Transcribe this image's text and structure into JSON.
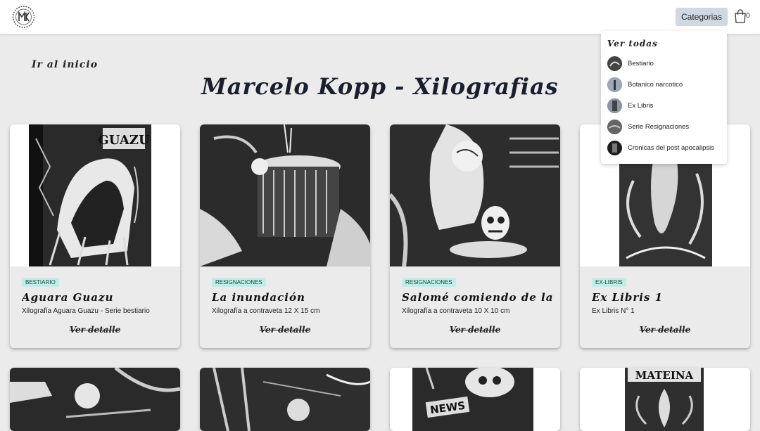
{
  "header": {
    "logo_icon": "mk-monogram-logo",
    "categories_label": "Categorias",
    "cart_icon": "shopping-bag-icon",
    "cart_count": "0"
  },
  "dropdown": {
    "all_label": "Ver todas",
    "items": [
      {
        "label": "Bestiario"
      },
      {
        "label": "Botanico narcotico"
      },
      {
        "label": "Ex Libris"
      },
      {
        "label": "Serie Resignaciones"
      },
      {
        "label": "Cronicas del post apocalipsis"
      }
    ]
  },
  "home_link": "Ir al inicio",
  "page_title": "Marcelo Kopp - Xilografias",
  "cards": [
    {
      "badge": "BESTIARIO",
      "title": "Aguara Guazu",
      "description": "Xilografía Aguara Guazu - Serie bestiario",
      "link": "Ver detalle"
    },
    {
      "badge": "RESIGNACIONES",
      "title": "La inundación",
      "description": "Xilografía a contraveta 12 X 15 cm",
      "link": "Ver detalle"
    },
    {
      "badge": "RESIGNACIONES",
      "title": "Salomé comiendo de la...",
      "description": "Xilografía a contraveta 10 X 10 cm",
      "link": "Ver detalle"
    },
    {
      "badge": "EX-LIBRIS",
      "title": "Ex Libris 1",
      "description": "Ex Libris N° 1",
      "link": "Ver detalle"
    }
  ],
  "second_row_texts": [
    "NEWS",
    "MATEINA"
  ],
  "colors": {
    "background": "#ebebeb",
    "title": "#1a1f2e",
    "badge_bg": "#bfeee8",
    "categories_button": "#d0d8e3"
  }
}
